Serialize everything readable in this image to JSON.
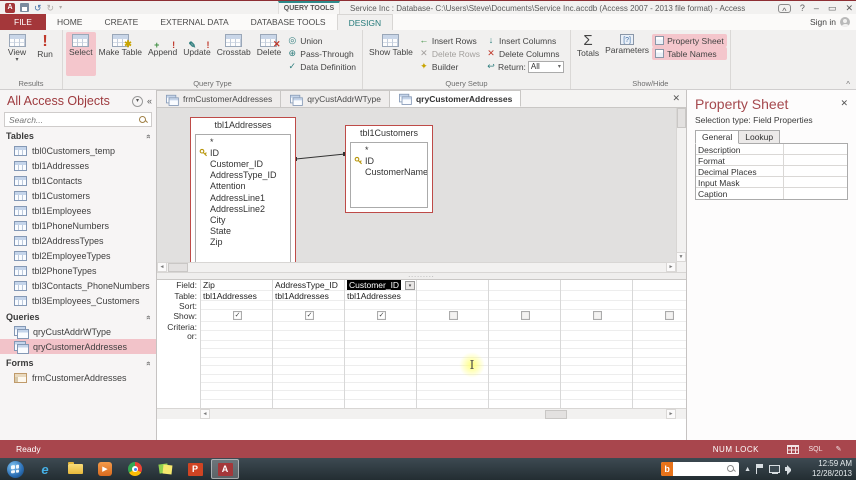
{
  "titlebar": {
    "app_title": "Service Inc : Database- C:\\Users\\Steve\\Documents\\Service Inc.accdb (Access 2007 - 2013 file format) - Access",
    "contextual_group": "QUERY TOOLS",
    "sign_in": "Sign in"
  },
  "ribbon": {
    "tabs": [
      {
        "label": "FILE",
        "file": true
      },
      {
        "label": "HOME"
      },
      {
        "label": "CREATE"
      },
      {
        "label": "EXTERNAL DATA"
      },
      {
        "label": "DATABASE TOOLS"
      },
      {
        "label": "DESIGN",
        "active": true
      }
    ],
    "groups": {
      "results": {
        "label": "Results",
        "view": "View",
        "run": "Run"
      },
      "query_type": {
        "label": "Query Type",
        "select": "Select",
        "make_table": "Make Table",
        "append": "Append",
        "update": "Update",
        "crosstab": "Crosstab",
        "delete": "Delete",
        "union": "Union",
        "pass_through": "Pass-Through",
        "data_definition": "Data Definition"
      },
      "query_setup": {
        "label": "Query Setup",
        "show_table": "Show Table",
        "insert_rows": "Insert Rows",
        "delete_rows": "Delete Rows",
        "builder": "Builder",
        "insert_columns": "Insert Columns",
        "delete_columns": "Delete Columns",
        "return_label": "Return:",
        "return_value": "All"
      },
      "show_hide": {
        "label": "Show/Hide",
        "totals": "Totals",
        "parameters": "Parameters",
        "property_sheet": "Property Sheet",
        "table_names": "Table Names"
      }
    }
  },
  "nav": {
    "title": "All Access Objects",
    "search_placeholder": "Search...",
    "groups": [
      {
        "label": "Tables",
        "items": [
          {
            "name": "tbl0Customers_temp"
          },
          {
            "name": "tbl1Addresses"
          },
          {
            "name": "tbl1Contacts"
          },
          {
            "name": "tbl1Customers"
          },
          {
            "name": "tbl1Employees"
          },
          {
            "name": "tbl1PhoneNumbers"
          },
          {
            "name": "tbl2AddressTypes"
          },
          {
            "name": "tbl2EmployeeTypes"
          },
          {
            "name": "tbl2PhoneTypes"
          },
          {
            "name": "tbl3Contacts_PhoneNumbers"
          },
          {
            "name": "tbl3Employees_Customers"
          }
        ]
      },
      {
        "label": "Queries",
        "items": [
          {
            "name": "qryCustAddrWType"
          },
          {
            "name": "qryCustomerAddresses",
            "selected": true
          }
        ]
      },
      {
        "label": "Forms",
        "items": [
          {
            "name": "frmCustomerAddresses"
          }
        ]
      }
    ]
  },
  "doc_tabs": [
    {
      "label": "frmCustomerAddresses",
      "form": true
    },
    {
      "label": "qryCustAddrWType"
    },
    {
      "label": "qryCustomerAddresses",
      "active": true
    }
  ],
  "design": {
    "tables": [
      {
        "name": "tbl1Addresses",
        "fields": [
          {
            "n": "*"
          },
          {
            "n": "ID",
            "key": true
          },
          {
            "n": "Customer_ID"
          },
          {
            "n": "AddressType_ID"
          },
          {
            "n": "Attention"
          },
          {
            "n": "AddressLine1"
          },
          {
            "n": "AddressLine2"
          },
          {
            "n": "City"
          },
          {
            "n": "State"
          },
          {
            "n": "Zip"
          }
        ]
      },
      {
        "name": "tbl1Customers",
        "fields": [
          {
            "n": "*"
          },
          {
            "n": "ID",
            "key": true
          },
          {
            "n": "CustomerName"
          }
        ]
      }
    ]
  },
  "grid": {
    "row_labels": [
      "Field:",
      "Table:",
      "Sort:",
      "Show:",
      "Criteria:",
      "or:"
    ],
    "columns": [
      {
        "field": "Zip",
        "table": "tbl1Addresses",
        "checked": true
      },
      {
        "field": "AddressType_ID",
        "table": "tbl1Addresses",
        "checked": true
      },
      {
        "field": "Customer_ID",
        "table": "tbl1Addresses",
        "checked": true,
        "selected": true
      },
      {
        "field": "",
        "table": ""
      },
      {
        "field": "",
        "table": ""
      },
      {
        "field": "",
        "table": ""
      },
      {
        "field": "",
        "table": ""
      }
    ]
  },
  "property_sheet": {
    "title": "Property Sheet",
    "selection_label": "Selection type:",
    "selection_value": "Field Properties",
    "tabs": [
      {
        "label": "General",
        "active": true
      },
      {
        "label": "Lookup"
      }
    ],
    "rows": [
      {
        "label": "Description"
      },
      {
        "label": "Format"
      },
      {
        "label": "Decimal Places"
      },
      {
        "label": "Input Mask"
      },
      {
        "label": "Caption"
      }
    ]
  },
  "status_bar": {
    "ready": "Ready",
    "num_lock": "NUM LOCK",
    "sql_text": "SQL"
  },
  "taskbar": {
    "search_logo": "b",
    "time": "12:59 AM",
    "date": "12/28/2013"
  },
  "colors": {
    "accent": "#A4373A",
    "highlight": "#F4C6CC",
    "contextual": "#2E8B8B",
    "selected_field_bg": "#000000"
  }
}
